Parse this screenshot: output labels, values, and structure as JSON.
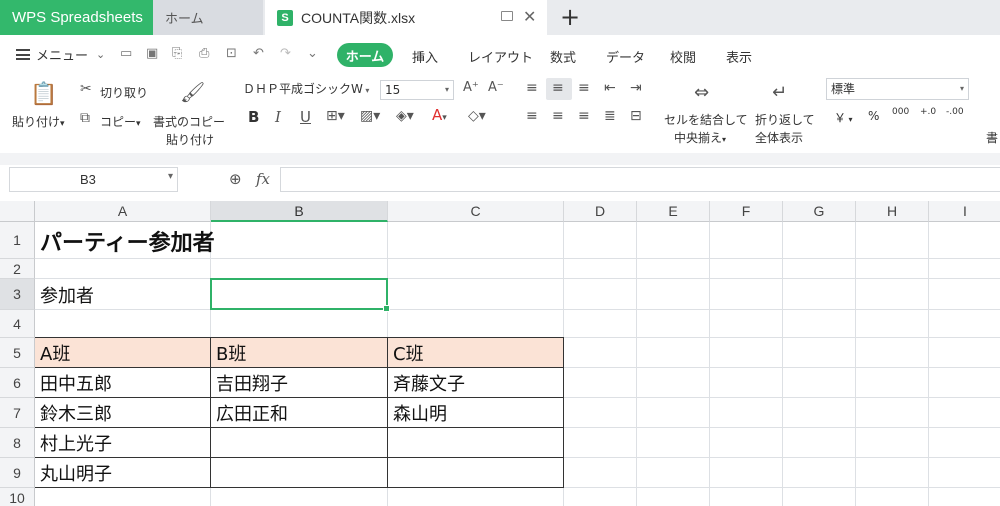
{
  "titlebar": {
    "app_tab": "WPS Spreadsheets",
    "home_tab": "ホーム",
    "file_tab": "COUNTA関数.xlsx",
    "file_icon": "S"
  },
  "menubar": {
    "menu_label": "メニュー",
    "ribbon_tabs": [
      "ホーム",
      "挿入",
      "レイアウト",
      "数式",
      "データ",
      "校閲",
      "表示"
    ]
  },
  "ribbon": {
    "paste": "貼り付け",
    "cut": "切り取り",
    "copy": "コピー",
    "format_copy_line1": "書式のコピー",
    "format_copy_line2": "貼り付け",
    "font_name": "ＤＨＰ平成ゴシックW",
    "font_size": "15",
    "merge_line1": "セルを結合して",
    "merge_line2": "中央揃え",
    "wrap_line1": "折り返して",
    "wrap_line2": "全体表示",
    "number_format": "標準",
    "currency": "￥",
    "percent": "%",
    "thousands": "000",
    "dec_inc": "+.0",
    "dec_dec": "-.00",
    "cut_off": "書"
  },
  "formula_bar": {
    "name_box": "B3",
    "fx_label": "fx",
    "formula": ""
  },
  "sheet": {
    "columns": [
      "A",
      "B",
      "C",
      "D",
      "E",
      "F",
      "G",
      "H",
      "I"
    ],
    "rows": [
      "1",
      "2",
      "3",
      "4",
      "5",
      "6",
      "7",
      "8",
      "9",
      "10"
    ],
    "title": "パーティー参加者",
    "label_participants": "参加者",
    "table_headers": [
      "A班",
      "B班",
      "C班"
    ],
    "table_rows": [
      [
        "田中五郎",
        "吉田翔子",
        "斉藤文子"
      ],
      [
        "鈴木三郎",
        "広田正和",
        "森山明"
      ],
      [
        "村上光子",
        "",
        ""
      ],
      [
        "丸山明子",
        "",
        ""
      ]
    ]
  },
  "colors": {
    "accent": "#2fb268",
    "header_fill": "#fbe3d6"
  }
}
